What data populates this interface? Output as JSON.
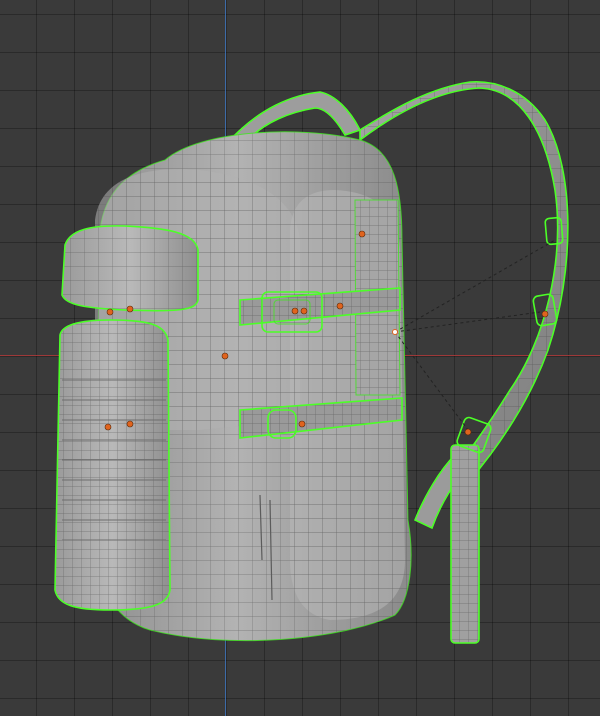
{
  "viewport": {
    "background_color": "#3a3a3a",
    "axis_x_color": "#b03a3a",
    "axis_y_color": "#3f78c4",
    "selection_color": "#4cff27",
    "mesh_color": "#a7a7a7",
    "origin_color": "#e0641e"
  },
  "object": {
    "type": "backpack-mesh",
    "selected": true,
    "origin_points_count": 12
  }
}
